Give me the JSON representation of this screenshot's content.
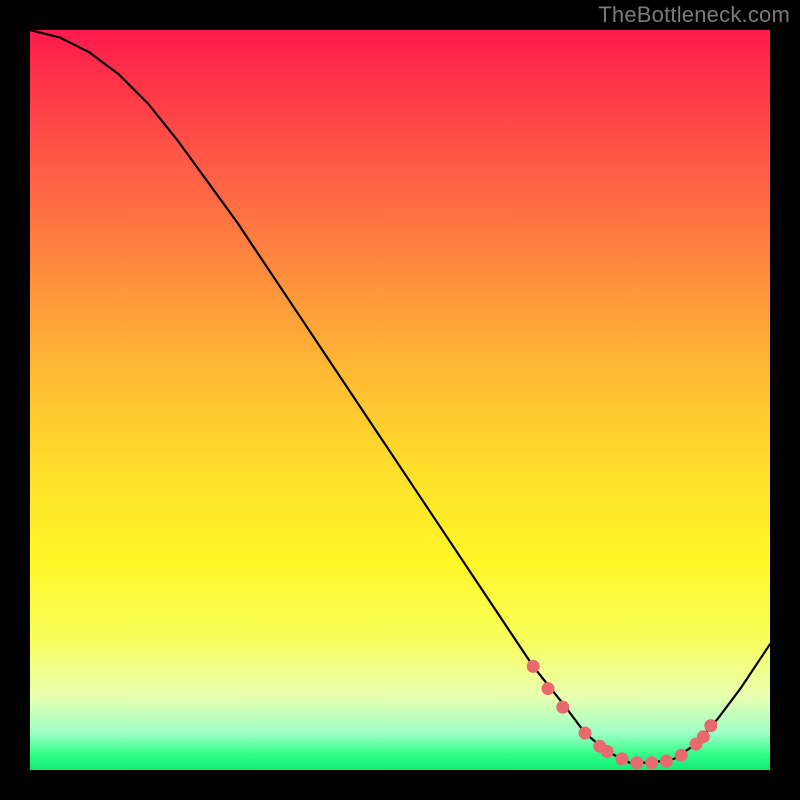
{
  "watermark": "TheBottleneck.com",
  "colors": {
    "background": "#000000",
    "curve_stroke": "#000000",
    "point_fill": "#e86a6e"
  },
  "chart_data": {
    "type": "line",
    "title": "",
    "xlabel": "",
    "ylabel": "",
    "xlim": [
      0,
      100
    ],
    "ylim": [
      0,
      100
    ],
    "grid": false,
    "legend": false,
    "x": [
      0,
      4,
      8,
      12,
      16,
      20,
      24,
      28,
      32,
      36,
      40,
      44,
      48,
      52,
      56,
      60,
      64,
      68,
      72,
      75,
      78,
      81,
      84,
      87,
      90,
      93,
      96,
      100
    ],
    "values": [
      100,
      99,
      97,
      94,
      90,
      85,
      79.5,
      74,
      68,
      62,
      56,
      50,
      44,
      38,
      32,
      26,
      20,
      14,
      9,
      5,
      2.5,
      1,
      1,
      1.5,
      3.5,
      7,
      11,
      17
    ],
    "highlighted_points": {
      "x": [
        68,
        70,
        72,
        75,
        77,
        78,
        80,
        82,
        84,
        86,
        88,
        90,
        91,
        92
      ],
      "y": [
        14,
        11,
        8.5,
        5,
        3.2,
        2.5,
        1.5,
        1.0,
        1.0,
        1.2,
        2.0,
        3.5,
        4.5,
        6.0
      ]
    }
  }
}
